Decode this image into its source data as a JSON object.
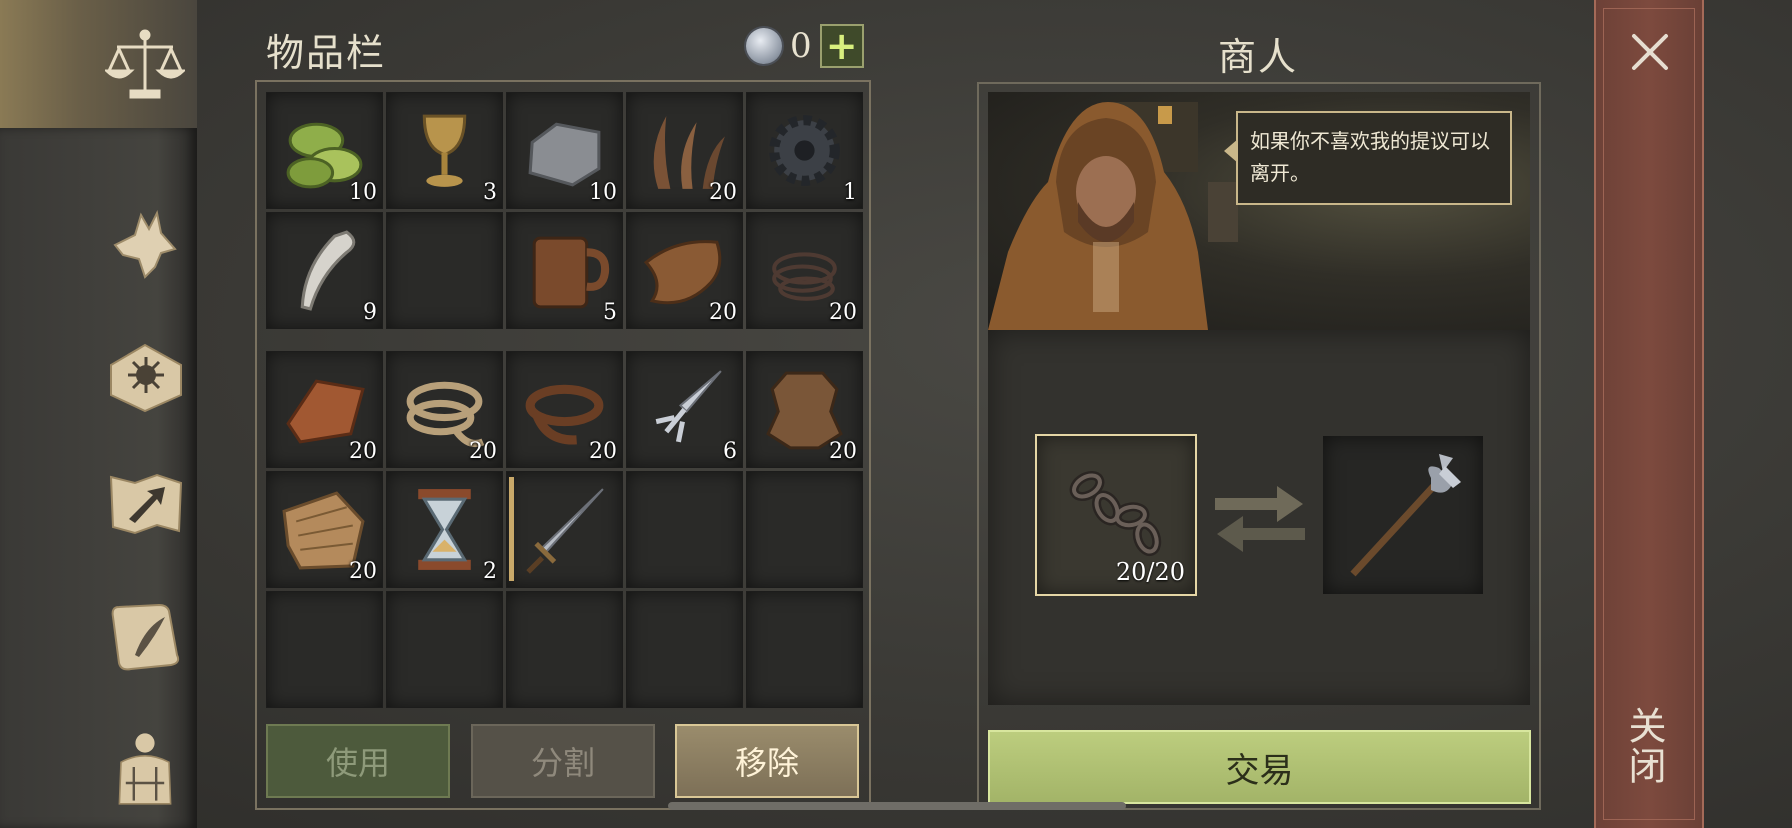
{
  "inventory": {
    "title": "物品栏",
    "currency_count": "0",
    "plus_label": "+",
    "grid_top": [
      {
        "name": "slot-herb-cakes",
        "icon": "green-herb-cakes-icon",
        "qty": "10"
      },
      {
        "name": "slot-goblet",
        "icon": "golden-goblet-icon",
        "qty": "3"
      },
      {
        "name": "slot-stone",
        "icon": "stone-block-icon",
        "qty": "10"
      },
      {
        "name": "slot-fiber",
        "icon": "plant-fiber-icon",
        "qty": "20"
      },
      {
        "name": "slot-gear",
        "icon": "iron-gear-icon",
        "qty": "1"
      },
      {
        "name": "slot-tusk",
        "icon": "bone-tusk-icon",
        "qty": "9"
      },
      {
        "name": "slot-empty-1",
        "icon": "",
        "qty": ""
      },
      {
        "name": "slot-mug",
        "icon": "wooden-mug-icon",
        "qty": "5"
      },
      {
        "name": "slot-leather-scrap",
        "icon": "leather-scrap-icon",
        "qty": "20"
      },
      {
        "name": "slot-wire",
        "icon": "wire-coil-icon",
        "qty": "20"
      }
    ],
    "grid_bottom": [
      {
        "name": "slot-copper-ingot",
        "icon": "copper-ingot-icon",
        "qty": "20"
      },
      {
        "name": "slot-rope",
        "icon": "rope-coil-icon",
        "qty": "20"
      },
      {
        "name": "slot-leather-belt",
        "icon": "leather-belt-icon",
        "qty": "20"
      },
      {
        "name": "slot-fork-blade",
        "icon": "forked-blade-icon",
        "qty": "6"
      },
      {
        "name": "slot-hide",
        "icon": "animal-hide-icon",
        "qty": "20"
      },
      {
        "name": "slot-cloth",
        "icon": "cloth-roll-icon",
        "qty": "20"
      },
      {
        "name": "slot-hourglass",
        "icon": "hourglass-icon",
        "qty": "2"
      },
      {
        "name": "slot-sword",
        "icon": "sword-icon",
        "qty": ""
      },
      {
        "name": "slot-empty-2",
        "icon": "",
        "qty": ""
      },
      {
        "name": "slot-empty-3",
        "icon": "",
        "qty": ""
      },
      {
        "name": "slot-empty-4",
        "icon": "",
        "qty": ""
      },
      {
        "name": "slot-empty-5",
        "icon": "",
        "qty": ""
      },
      {
        "name": "slot-empty-6",
        "icon": "",
        "qty": ""
      },
      {
        "name": "slot-empty-7",
        "icon": "",
        "qty": ""
      },
      {
        "name": "slot-empty-8",
        "icon": "",
        "qty": ""
      }
    ],
    "buttons": {
      "use": "使用",
      "split": "分割",
      "remove": "移除"
    }
  },
  "merchant": {
    "title": "商人",
    "speech": "如果你不喜欢我的提议可以离开。",
    "give_qty": "20/20",
    "give_icon": "chain-icon",
    "get_icon": "halberd-icon",
    "trade_label": "交易"
  },
  "close_label": "关闭",
  "nav": [
    "scales-icon",
    "wolf-icon",
    "sun-book-icon",
    "map-arrow-icon",
    "scroll-quill-icon",
    "character-armor-icon"
  ],
  "colors": {
    "trade_button": "#b1c173",
    "remove_button": "#8d7f62",
    "close_bar": "#784638",
    "accent_gold": "#c9b78a"
  }
}
